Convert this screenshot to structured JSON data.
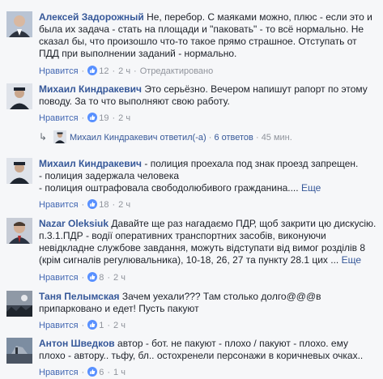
{
  "comments": [
    {
      "author": "Алексей Задорожный",
      "text": "Не, перебор. С маяками можно, плюс - если это и была их задача - стать на площади и \"паковать\" - то всё нормально. Не сказал бы, что произошло что-то такое прямо страшное. Отступать от ПДД при выполнении заданий - нормально.",
      "like_label": "Нравится",
      "likes": "12",
      "time": "2 ч",
      "extra": "Отредактировано"
    },
    {
      "author": "Михаил Киндракевич",
      "text": "Это серьёзно. Вечером напишут рапорт по этому поводу. За то что выполняют свою работу.",
      "like_label": "Нравится",
      "likes": "19",
      "time": "2 ч"
    },
    {
      "author": "Михаил Киндракевич",
      "text_lines": [
        "- полиция проехала под знак проезд запрещен.",
        "- полиция задержала человека",
        "- полиция оштрафовала свободолюбивого гражданина...."
      ],
      "more_label": "Еще",
      "like_label": "Нравится",
      "likes": "18",
      "time": "2 ч"
    },
    {
      "author": "Nazar Oleksiuk",
      "text": "Давайте ще раз нагадаємо ПДР, щоб закрити цю дискусію. п.3.1.ПДР - водії оперативних транспортних засобів, виконуючи невідкладне службове завдання, можуть відступати від вимог розділів 8 (крім сигналів регулювальника), 10-18, 26, 27 та пункту 28.1 цих ...",
      "more_label": "Еще",
      "like_label": "Нравится",
      "likes": "8",
      "time": "2 ч"
    },
    {
      "author": "Таня Пелымская",
      "text": "Зачем уехали??? Там столько долго@@@в припарковано и едет! Пусть пакуют",
      "like_label": "Нравится",
      "likes": "1",
      "time": "2 ч"
    },
    {
      "author": "Антон Шведков",
      "text": "автор - бот. не пакуют - плохо / пакуют - плохо. ему плохо - автору.. тьфу, бл.. остохренели персонажи в коричневых очках..",
      "like_label": "Нравится",
      "likes": "6",
      "time": "1 ч"
    }
  ],
  "replies": {
    "author": "Михаил Киндракевич",
    "action": "ответил(-а)",
    "sep": "·",
    "count": "6 ответов",
    "time": "45 мин."
  },
  "colors": {
    "link": "#365899",
    "like": "#4267b2",
    "meta": "#90949c",
    "text": "#1d2129",
    "background": "#f6f7f9"
  },
  "icons": {
    "like": "thumbs-up-icon",
    "reply": "reply-arrow-icon"
  }
}
